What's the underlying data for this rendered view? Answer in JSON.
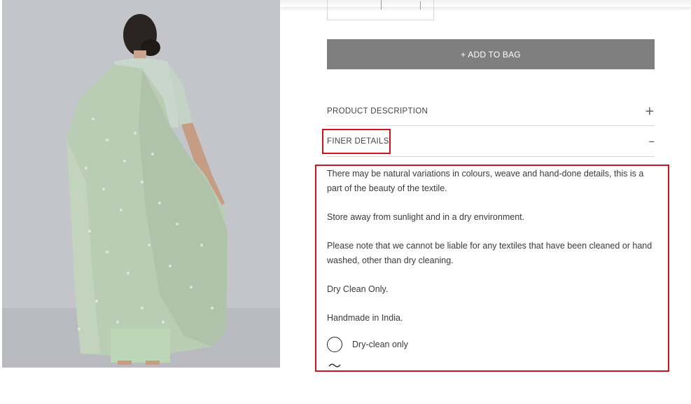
{
  "product": {
    "add_to_bag_label": "+ ADD TO BAG"
  },
  "accordion": [
    {
      "label": "PRODUCT DESCRIPTION",
      "icon": "+"
    },
    {
      "label": "FINER DETAILS",
      "icon": "–"
    }
  ],
  "finer_details": {
    "paragraphs": [
      "There may be natural variations in colours, weave and hand-done details, this is a part of the beauty of the textile.",
      "Store away from sunlight and in a dry environment.",
      "Please note that we cannot be liable for any textiles that have been cleaned or hand washed, other than dry cleaning.",
      "Dry Clean Only.",
      "Handmade in India."
    ],
    "care_icons": [
      {
        "icon": "dry-clean-circle-icon",
        "label": "Dry-clean only"
      }
    ]
  },
  "colors": {
    "button_bg": "#7f7f7f",
    "highlight": "#d0121b",
    "saree_green": "#b7c9b2"
  }
}
